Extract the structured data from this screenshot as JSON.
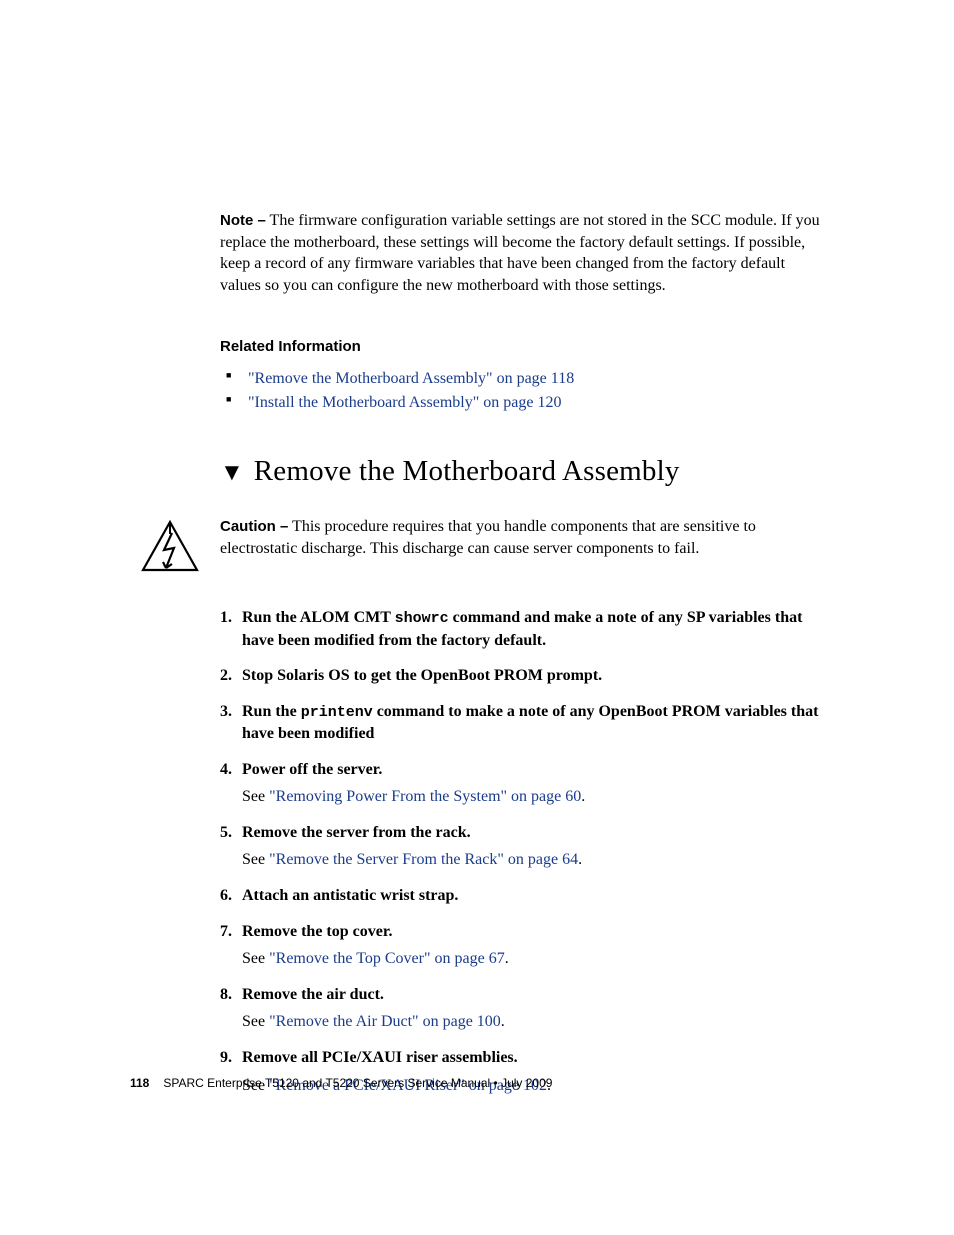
{
  "note": {
    "label": "Note –",
    "text": " The firmware configuration variable settings are not stored in the SCC module. If you replace the motherboard, these settings will become the factory default settings. If possible, keep a record of any firmware variables that have been changed from the factory default values so you can configure the new motherboard with those settings."
  },
  "related": {
    "heading": "Related Information",
    "items": [
      "\"Remove the Motherboard Assembly\" on page 118",
      "\"Install the Motherboard Assembly\" on page 120"
    ]
  },
  "section_title": "Remove the Motherboard Assembly",
  "caution": {
    "label": "Caution –",
    "text": " This procedure requires that you handle components that are sensitive to electrostatic discharge. This discharge can cause server components to fail."
  },
  "steps": [
    {
      "num": "1.",
      "pre": "Run the ALOM CMT ",
      "code": "showrc",
      "post": " command and make a note of any SP variables that have been modified from the factory default."
    },
    {
      "num": "2.",
      "pre": "Stop Solaris OS to get the OpenBoot PROM prompt."
    },
    {
      "num": "3.",
      "pre": "Run the ",
      "code": "printenv",
      "post": " command to make a note of any OpenBoot PROM variables that have been modified"
    },
    {
      "num": "4.",
      "pre": "Power off the server.",
      "see_prefix": "See ",
      "see_link": "\"Removing Power From the System\" on page 60",
      "see_suffix": "."
    },
    {
      "num": "5.",
      "pre": "Remove the server from the rack.",
      "see_prefix": "See ",
      "see_link": "\"Remove the Server From the Rack\" on page 64",
      "see_suffix": "."
    },
    {
      "num": "6.",
      "pre": "Attach an antistatic wrist strap."
    },
    {
      "num": "7.",
      "pre": "Remove the top cover.",
      "see_prefix": "See ",
      "see_link": "\"Remove the Top Cover\" on page 67",
      "see_suffix": "."
    },
    {
      "num": "8.",
      "pre": "Remove the air duct.",
      "see_prefix": "See ",
      "see_link": "\"Remove the Air Duct\" on page 100",
      "see_suffix": "."
    },
    {
      "num": "9.",
      "pre": "Remove all PCIe/XAUI riser assemblies.",
      "see_prefix": "See ",
      "see_link": "\"Remove a PCIe/XAUI Riser\" on page 102",
      "see_suffix": "."
    }
  ],
  "footer": {
    "page_number": "118",
    "text": "SPARC Enterprise T5120 and T5220 Servers Service Manual  •  July 2009"
  }
}
